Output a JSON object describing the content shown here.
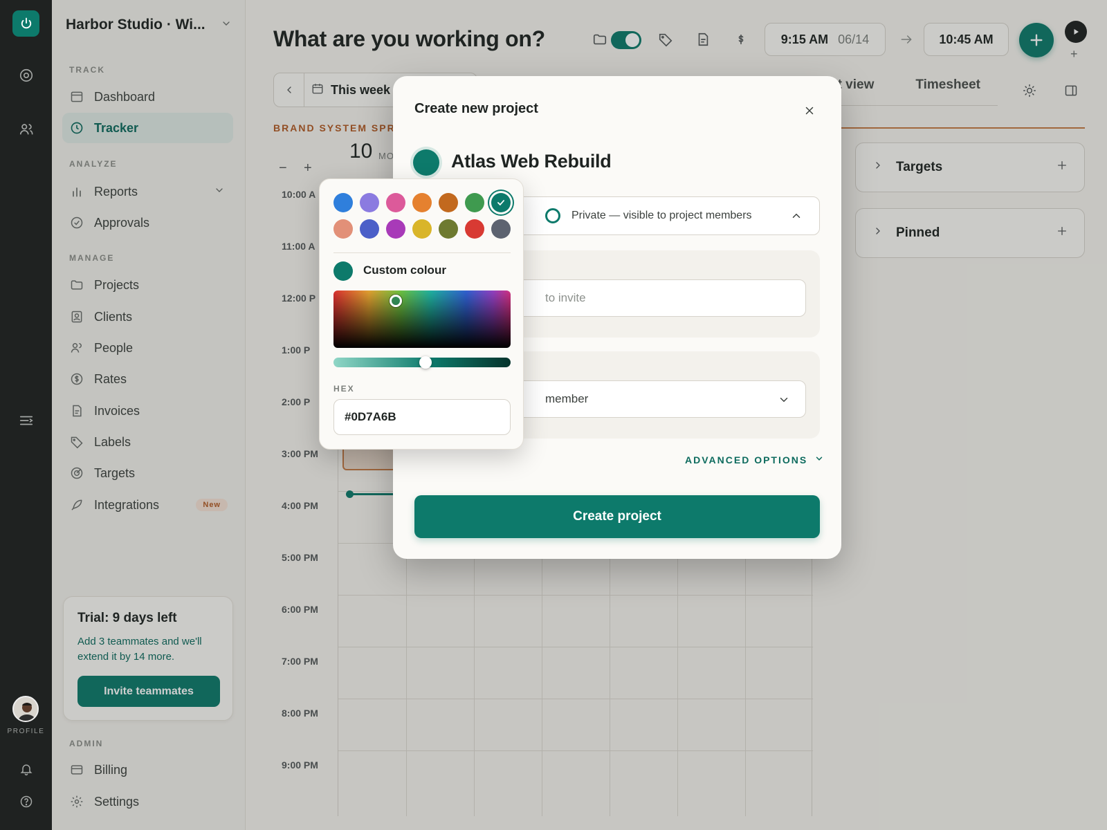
{
  "rail": {
    "profile_label": "PROFILE",
    "icons": [
      "power-icon",
      "target-icon",
      "people-icon",
      "collapse-icon",
      "bell-icon",
      "help-icon"
    ]
  },
  "sidebar": {
    "workspace": "Harbor Studio · Wi...",
    "sections": {
      "track": "TRACK",
      "analyze": "ANALYZE",
      "manage": "MANAGE",
      "admin": "ADMIN"
    },
    "items": [
      {
        "label": "Dashboard"
      },
      {
        "label": "Tracker"
      },
      {
        "label": "Reports"
      },
      {
        "label": "Approvals"
      },
      {
        "label": "Projects"
      },
      {
        "label": "Clients"
      },
      {
        "label": "People"
      },
      {
        "label": "Rates"
      },
      {
        "label": "Invoices"
      },
      {
        "label": "Labels"
      },
      {
        "label": "Targets"
      },
      {
        "label": "Integrations",
        "badge": "New"
      },
      {
        "label": "Billing"
      },
      {
        "label": "Settings"
      }
    ],
    "trial": {
      "title": "Trial: 9 days left",
      "text": "Add 3 teammates and we'll extend it by 14 more.",
      "button": "Invite teammates"
    }
  },
  "header": {
    "title": "What are you working on?",
    "start_time": "9:15 AM",
    "start_date": "06/14",
    "end_time": "10:45 AM"
  },
  "calendar": {
    "week_label": "This week",
    "project_label": "BRAND SYSTEM SPRI",
    "day_number": "10",
    "day_name": "MO",
    "hours": [
      "10:00 A",
      "11:00 A",
      "12:00 P",
      "1:00 P",
      "2:00 P",
      "3:00 PM",
      "4:00 PM",
      "5:00 PM",
      "6:00 PM",
      "7:00 PM",
      "8:00 PM",
      "9:00 PM"
    ]
  },
  "views": {
    "list_tab": "st view",
    "timesheet_tab": "Timesheet"
  },
  "panels": [
    {
      "label": "Targets"
    },
    {
      "label": "Pinned"
    }
  ],
  "modal": {
    "title": "Create new project",
    "project_name": "Atlas Web Rebuild",
    "visibility": "Private — visible to project members",
    "invite_placeholder": "to invite",
    "role_value": "member",
    "advanced": "ADVANCED OPTIONS",
    "create_button": "Create project"
  },
  "color_picker": {
    "swatches": [
      "#2f7fdc",
      "#8b7be0",
      "#dc5a9a",
      "#e5812f",
      "#c2691e",
      "#3f9a4f",
      "#0d7a6b",
      "#e29078",
      "#4b5fc8",
      "#a83ab8",
      "#d9b52a",
      "#6e7a30",
      "#d83a33",
      "#5d6370"
    ],
    "selected_index": 6,
    "custom_label": "Custom colour",
    "hex_label": "HEX",
    "hex_value": "#0D7A6B",
    "lightness": 0.52
  },
  "colors": {
    "accent": "#0d7a6b",
    "warm": "#c67a45"
  }
}
